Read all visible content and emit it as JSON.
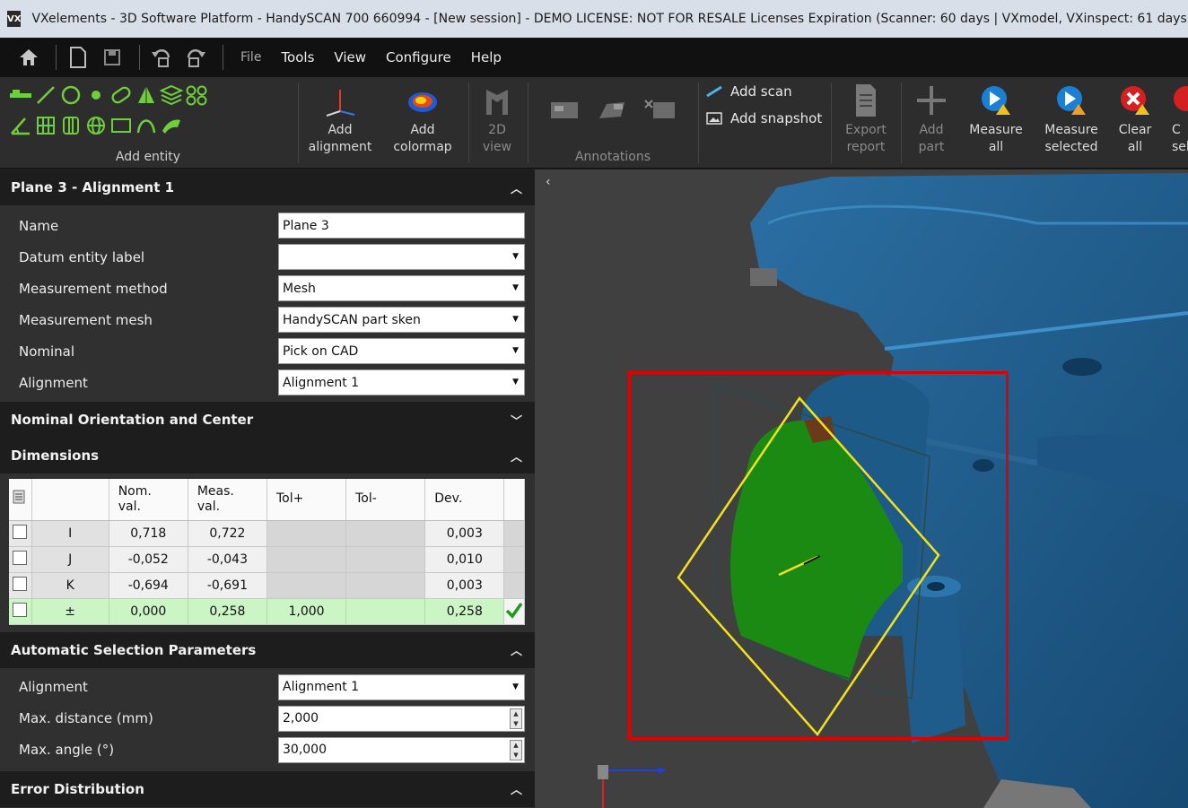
{
  "window": {
    "title": "VXelements - 3D Software Platform - HandySCAN 700 660994 - [New session] - DEMO LICENSE: NOT FOR RESALE Licenses Expiration (Scanner: 60 days | VXmodel, VXinspect: 61 days)"
  },
  "menu": {
    "items": [
      "File",
      "Tools",
      "View",
      "Configure",
      "Help"
    ]
  },
  "ribbon": {
    "add_entity_label": "Add entity",
    "add_alignment": [
      "Add",
      "alignment"
    ],
    "add_colormap": [
      "Add",
      "colormap"
    ],
    "view_2d": [
      "2D",
      "view"
    ],
    "annotations_label": "Annotations",
    "add_scan": "Add scan",
    "add_snapshot": "Add snapshot",
    "export_report": [
      "Export",
      "report"
    ],
    "add_part": [
      "Add",
      "part"
    ],
    "measure_all": [
      "Measure",
      "all"
    ],
    "measure_selected": [
      "Measure",
      "selected"
    ],
    "clear_all": [
      "Clear",
      "all"
    ],
    "clear_selected": [
      "C",
      "sel"
    ]
  },
  "panel": {
    "title": "Plane 3 - Alignment 1",
    "props": {
      "name_label": "Name",
      "name_value": "Plane 3",
      "datum_label": "Datum entity label",
      "datum_value": "",
      "method_label": "Measurement method",
      "method_value": "Mesh",
      "mesh_label": "Measurement mesh",
      "mesh_value": "HandySCAN part sken",
      "nominal_label": "Nominal",
      "nominal_value": "Pick on CAD",
      "alignment_label": "Alignment",
      "alignment_value": "Alignment 1"
    },
    "section_orientation": "Nominal Orientation and Center",
    "section_dimensions": "Dimensions",
    "dims": {
      "headers": [
        "Nom.\nval.",
        "Meas.\nval.",
        "Tol+",
        "Tol-",
        "Dev."
      ],
      "h_nom_1": "Nom.",
      "h_nom_2": "val.",
      "h_meas_1": "Meas.",
      "h_meas_2": "val.",
      "h_tolp": "Tol+",
      "h_tolm": "Tol-",
      "h_dev": "Dev.",
      "rows": [
        {
          "axis": "I",
          "nom": "0,718",
          "meas": "0,722",
          "tolp": "",
          "tolm": "",
          "dev": "0,003"
        },
        {
          "axis": "J",
          "nom": "-0,052",
          "meas": "-0,043",
          "tolp": "",
          "tolm": "",
          "dev": "0,010"
        },
        {
          "axis": "K",
          "nom": "-0,694",
          "meas": "-0,691",
          "tolp": "",
          "tolm": "",
          "dev": "0,003"
        },
        {
          "axis": "±",
          "nom": "0,000",
          "meas": "0,258",
          "tolp": "1,000",
          "tolm": "",
          "dev": "0,258"
        }
      ]
    },
    "section_auto": "Automatic Selection Parameters",
    "auto": {
      "alignment_label": "Alignment",
      "alignment_value": "Alignment 1",
      "maxdist_label": "Max. distance (mm)",
      "maxdist_value": "2,000",
      "maxangle_label": "Max. angle (°)",
      "maxangle_value": "30,000"
    },
    "section_error": "Error Distribution"
  },
  "colors": {
    "scan_blue": "#1f5f8f",
    "plane_green": "#1b8a12",
    "selection_red": "#e00000",
    "plane_outline_yellow": "#f2e21b"
  }
}
